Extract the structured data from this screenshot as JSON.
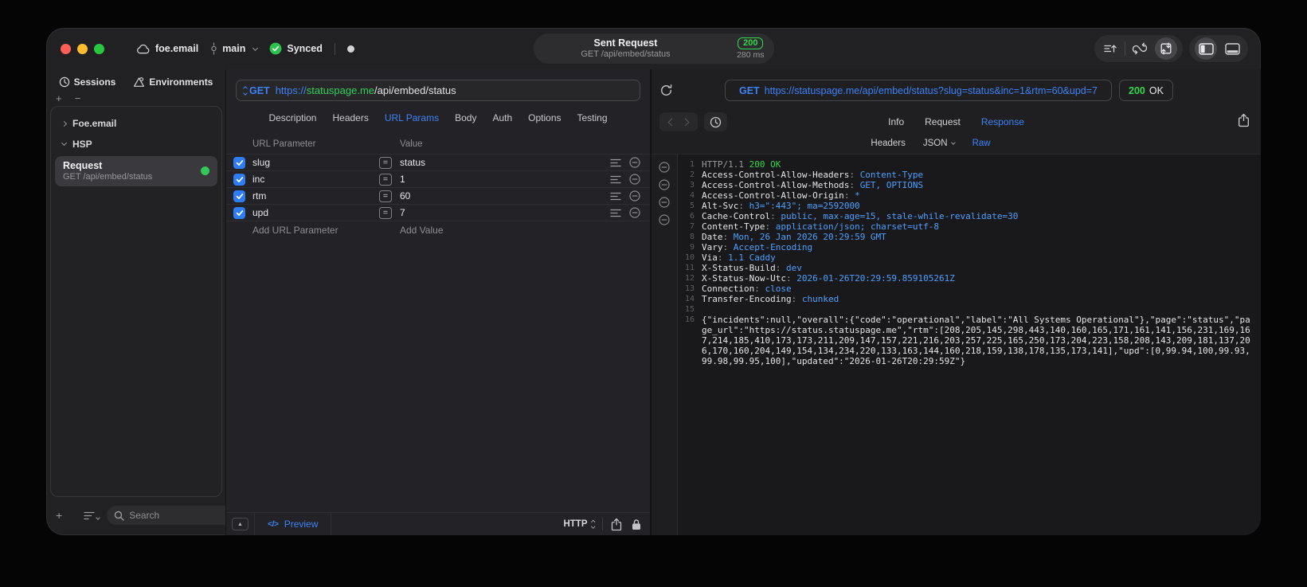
{
  "glyphs": {
    "plus": "+",
    "minus": "−",
    "triangle_up": "▲",
    "eq": "=",
    "code": "</>"
  },
  "colors": {
    "accent_blue": "#3d82f6",
    "status_green": "#32d74b",
    "url_host_green": "#30d158"
  },
  "titlebar": {
    "project": "foe.email",
    "branch": "main",
    "sync_status": "Synced",
    "request": {
      "title": "Sent Request",
      "subtitle": "GET /api/embed/status",
      "status_code": "200",
      "duration": "280 ms"
    }
  },
  "sidebar": {
    "tabs": [
      {
        "label": "Sessions"
      },
      {
        "label": "Environments"
      }
    ],
    "groups": [
      {
        "label": "Foe.email",
        "state": "collapsed"
      },
      {
        "label": "HSP",
        "state": "expanded"
      }
    ],
    "request_item": {
      "title": "Request",
      "subtitle": "GET /api/embed/status"
    },
    "search_placeholder": "Search"
  },
  "request_editor": {
    "method": "GET",
    "url": {
      "scheme": "https://",
      "host": "statuspage.me",
      "path": "/api/embed/status"
    },
    "tabs": [
      {
        "label": "Description",
        "state": "normal"
      },
      {
        "label": "Headers",
        "state": "normal"
      },
      {
        "label": "URL Params",
        "state": "active"
      },
      {
        "label": "Body",
        "state": "normal"
      },
      {
        "label": "Auth",
        "state": "normal"
      },
      {
        "label": "Options",
        "state": "normal"
      },
      {
        "label": "Testing",
        "state": "normal"
      }
    ],
    "params": {
      "columns": {
        "name": "URL Parameter",
        "value": "Value"
      },
      "rows": [
        {
          "name": "slug",
          "value": "status",
          "enabled": true
        },
        {
          "name": "inc",
          "value": "1",
          "enabled": true
        },
        {
          "name": "rtm",
          "value": "60",
          "enabled": true
        },
        {
          "name": "upd",
          "value": "7",
          "enabled": true
        }
      ],
      "add_name": "Add URL Parameter",
      "add_value": "Add Value"
    },
    "footer": {
      "preview_label": "Preview",
      "protocol": "HTTP"
    }
  },
  "response_viewer": {
    "request_line": {
      "method": "GET",
      "url": "https://statuspage.me/api/embed/status?slug=status&inc=1&rtm=60&upd=7"
    },
    "status": {
      "code": "200",
      "text": "OK"
    },
    "tabs": [
      {
        "label": "Info",
        "state": "normal"
      },
      {
        "label": "Request",
        "state": "normal"
      },
      {
        "label": "Response",
        "state": "active"
      }
    ],
    "subtabs": [
      {
        "label": "Headers",
        "state": "normal"
      },
      {
        "label": "JSON",
        "state": "normal"
      },
      {
        "label": "Raw",
        "state": "active"
      }
    ],
    "body_lines": [
      {
        "n": "1",
        "segs": [
          {
            "t": "HTTP/1.1 ",
            "c": "seg-dim"
          },
          {
            "t": "200 OK",
            "c": "seg-green"
          }
        ]
      },
      {
        "n": "2",
        "segs": [
          {
            "t": "Access-Control-Allow-Headers",
            "c": "seg-key"
          },
          {
            "t": ": ",
            "c": "seg-dim"
          },
          {
            "t": "Content-Type",
            "c": "seg-val"
          }
        ]
      },
      {
        "n": "3",
        "segs": [
          {
            "t": "Access-Control-Allow-Methods",
            "c": "seg-key"
          },
          {
            "t": ": ",
            "c": "seg-dim"
          },
          {
            "t": "GET, OPTIONS",
            "c": "seg-val"
          }
        ]
      },
      {
        "n": "4",
        "segs": [
          {
            "t": "Access-Control-Allow-Origin",
            "c": "seg-key"
          },
          {
            "t": ": ",
            "c": "seg-dim"
          },
          {
            "t": "*",
            "c": "seg-val"
          }
        ]
      },
      {
        "n": "5",
        "segs": [
          {
            "t": "Alt-Svc",
            "c": "seg-key"
          },
          {
            "t": ": ",
            "c": "seg-dim"
          },
          {
            "t": "h3=\":443\"; ma=2592000",
            "c": "seg-val"
          }
        ]
      },
      {
        "n": "6",
        "segs": [
          {
            "t": "Cache-Control",
            "c": "seg-key"
          },
          {
            "t": ": ",
            "c": "seg-dim"
          },
          {
            "t": "public, max-age=15, stale-while-revalidate=30",
            "c": "seg-val"
          }
        ]
      },
      {
        "n": "7",
        "segs": [
          {
            "t": "Content-Type",
            "c": "seg-key"
          },
          {
            "t": ": ",
            "c": "seg-dim"
          },
          {
            "t": "application/json; charset=utf-8",
            "c": "seg-val"
          }
        ]
      },
      {
        "n": "8",
        "segs": [
          {
            "t": "Date",
            "c": "seg-key"
          },
          {
            "t": ": ",
            "c": "seg-dim"
          },
          {
            "t": "Mon, 26 Jan 2026 20:29:59 GMT",
            "c": "seg-val"
          }
        ]
      },
      {
        "n": "9",
        "segs": [
          {
            "t": "Vary",
            "c": "seg-key"
          },
          {
            "t": ": ",
            "c": "seg-dim"
          },
          {
            "t": "Accept-Encoding",
            "c": "seg-val"
          }
        ]
      },
      {
        "n": "10",
        "segs": [
          {
            "t": "Via",
            "c": "seg-key"
          },
          {
            "t": ": ",
            "c": "seg-dim"
          },
          {
            "t": "1.1 Caddy",
            "c": "seg-val"
          }
        ]
      },
      {
        "n": "11",
        "segs": [
          {
            "t": "X-Status-Build",
            "c": "seg-key"
          },
          {
            "t": ": ",
            "c": "seg-dim"
          },
          {
            "t": "dev",
            "c": "seg-val"
          }
        ]
      },
      {
        "n": "12",
        "segs": [
          {
            "t": "X-Status-Now-Utc",
            "c": "seg-key"
          },
          {
            "t": ": ",
            "c": "seg-dim"
          },
          {
            "t": "2026-01-26T20:29:59.859105261Z",
            "c": "seg-val"
          }
        ]
      },
      {
        "n": "13",
        "segs": [
          {
            "t": "Connection",
            "c": "seg-key"
          },
          {
            "t": ": ",
            "c": "seg-dim"
          },
          {
            "t": "close",
            "c": "seg-val"
          }
        ]
      },
      {
        "n": "14",
        "segs": [
          {
            "t": "Transfer-Encoding",
            "c": "seg-key"
          },
          {
            "t": ": ",
            "c": "seg-dim"
          },
          {
            "t": "chunked",
            "c": "seg-val"
          }
        ]
      },
      {
        "n": "15",
        "segs": []
      },
      {
        "n": "16",
        "segs": [
          {
            "t": "{\"incidents\":null,\"overall\":{\"code\":\"operational\",\"label\":\"All Systems Operational\"},\"page\":\"status\",\"page_url\":\"https://status.statuspage.me\",\"rtm\":[208,205,145,298,443,140,160,165,171,161,141,156,231,169,167,214,185,410,173,173,211,209,147,157,221,216,203,257,225,165,250,173,204,223,158,208,143,209,181,137,206,170,160,204,149,154,134,234,220,133,163,144,160,218,159,138,178,135,173,141],\"upd\":[0,99.94,100,99.93,99.98,99.95,100],\"updated\":\"2026-01-26T20:29:59Z\"}",
            "c": "seg-plain"
          }
        ]
      }
    ]
  }
}
